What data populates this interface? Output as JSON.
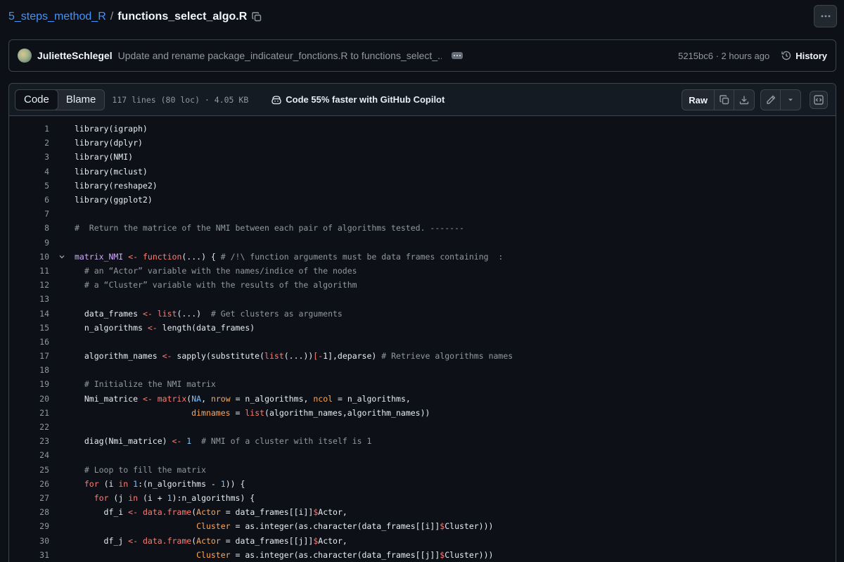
{
  "breadcrumb": {
    "repo": "5_steps_method_R",
    "separator": "/",
    "file": "functions_select_algo.R"
  },
  "commit": {
    "author": "JulietteSchlegel",
    "message": "Update and rename package_indicateur_fonctions.R to functions_select_...",
    "sha_time": "5215bc6 · 2 hours ago",
    "history_label": "History"
  },
  "file_header": {
    "tabs": [
      "Code",
      "Blame"
    ],
    "active_tab": "Code",
    "meta": "117 lines (80 loc) · 4.05 KB",
    "copilot": "Code 55% faster with GitHub Copilot",
    "raw_label": "Raw"
  },
  "code_lines": [
    {
      "n": "1",
      "t": "library(igraph)"
    },
    {
      "n": "2",
      "t": "library(dplyr)"
    },
    {
      "n": "3",
      "t": "library(NMI)"
    },
    {
      "n": "4",
      "t": "library(mclust)"
    },
    {
      "n": "5",
      "t": "library(reshape2)"
    },
    {
      "n": "6",
      "t": "library(ggplot2)"
    },
    {
      "n": "7",
      "t": ""
    },
    {
      "n": "8",
      "t": "#  Return the matrice of the NMI between each pair of algorithms tested. -------"
    },
    {
      "n": "9",
      "t": ""
    },
    {
      "n": "10",
      "t": "matrix_NMI <- function(...) { # /!\\ function arguments must be data frames containing  :"
    },
    {
      "n": "11",
      "t": "  # an “Actor” variable with the names/indice of the nodes"
    },
    {
      "n": "12",
      "t": "  # a “Cluster” variable with the results of the algorithm"
    },
    {
      "n": "13",
      "t": ""
    },
    {
      "n": "14",
      "t": "  data_frames <- list(...)  # Get clusters as arguments"
    },
    {
      "n": "15",
      "t": "  n_algorithms <- length(data_frames)"
    },
    {
      "n": "16",
      "t": ""
    },
    {
      "n": "17",
      "t": "  algorithm_names <- sapply(substitute(list(...))[-1],deparse) # Retrieve algorithms names"
    },
    {
      "n": "18",
      "t": ""
    },
    {
      "n": "19",
      "t": "  # Initialize the NMI matrix"
    },
    {
      "n": "20",
      "t": "  Nmi_matrice <- matrix(NA, nrow = n_algorithms, ncol = n_algorithms,"
    },
    {
      "n": "21",
      "t": "                        dimnames = list(algorithm_names,algorithm_names))"
    },
    {
      "n": "22",
      "t": ""
    },
    {
      "n": "23",
      "t": "  diag(Nmi_matrice) <- 1  # NMI of a cluster with itself is 1"
    },
    {
      "n": "24",
      "t": ""
    },
    {
      "n": "25",
      "t": "  # Loop to fill the matrix"
    },
    {
      "n": "26",
      "t": "  for (i in 1:(n_algorithms - 1)) {"
    },
    {
      "n": "27",
      "t": "    for (j in (i + 1):n_algorithms) {"
    },
    {
      "n": "28",
      "t": "      df_i <- data.frame(Actor = data_frames[[i]]$Actor,"
    },
    {
      "n": "29",
      "t": "                         Cluster = as.integer(as.character(data_frames[[i]]$Cluster)))"
    },
    {
      "n": "30",
      "t": "      df_j <- data.frame(Actor = data_frames[[j]]$Actor,"
    },
    {
      "n": "31",
      "t": "                         Cluster = as.integer(as.character(data_frames[[j]]$Cluster)))"
    }
  ],
  "icons": {
    "copy_path": "copy-icon",
    "more": "kebab-horizontal-icon",
    "history": "history-icon",
    "copilot": "copilot-icon",
    "copy_raw": "copy-icon",
    "download": "download-icon",
    "edit": "pencil-icon",
    "edit_menu": "triangle-down-icon",
    "symbols": "code-square-icon",
    "fold": "chevron-down-icon"
  },
  "colors": {
    "link": "#4493f8",
    "comment": "#9198a1",
    "keyword": "#ff7b72",
    "function": "#d2a8ff",
    "number": "#79c0ff",
    "argument": "#ffa657"
  }
}
